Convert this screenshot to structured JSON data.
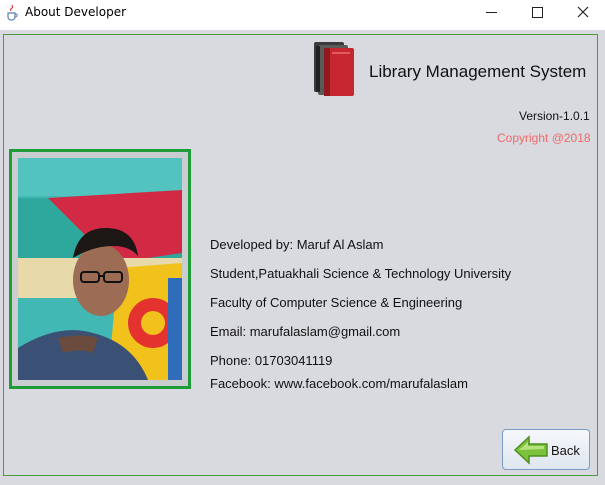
{
  "window": {
    "title": "About Developer",
    "icon": "java-cup-icon",
    "controls": [
      "minimize-icon",
      "maximize-icon",
      "close-icon"
    ]
  },
  "header": {
    "app_title": "Library Management System",
    "logo_icon": "books-icon",
    "version": "Version-1.0.1",
    "copyright": "Copyright @2018"
  },
  "developer": {
    "developed_by": "Developed by: Maruf Al Aslam",
    "student": "Student,Patuakhali Science & Technology University",
    "faculty": "Faculty of Computer Science & Engineering",
    "email": "Email: marufalaslam@gmail.com",
    "phone": "Phone: 01703041119",
    "facebook": "Facebook: www.facebook.com/marufalaslam"
  },
  "buttons": {
    "back_label": "Back",
    "back_icon": "arrow-left-icon"
  },
  "colors": {
    "background": "#d8dadf",
    "photo_border": "#1f9c3a",
    "copyright": "#ef6a6a",
    "frame_border": "#4e9a3c"
  }
}
